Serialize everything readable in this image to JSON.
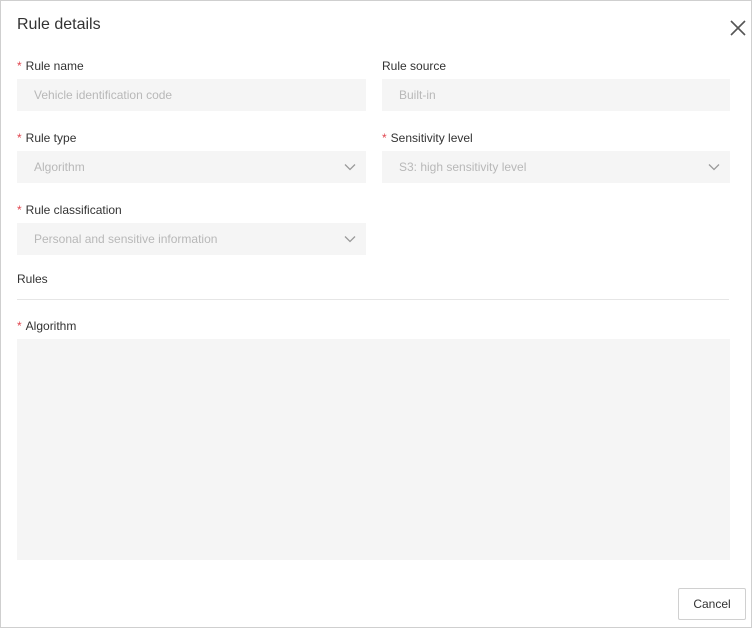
{
  "dialog": {
    "title": "Rule details",
    "close_icon": "close-icon"
  },
  "form": {
    "required_marker": "*",
    "rule_name": {
      "label": "Rule name",
      "required": true,
      "value": "Vehicle identification code"
    },
    "rule_source": {
      "label": "Rule source",
      "required": false,
      "value": "Built-in"
    },
    "rule_type": {
      "label": "Rule type",
      "required": true,
      "value": "Algorithm",
      "icon": "chevron-down-icon"
    },
    "sensitivity_level": {
      "label": "Sensitivity level",
      "required": true,
      "value": "S3: high sensitivity level",
      "icon": "chevron-down-icon"
    },
    "rule_classification": {
      "label": "Rule classification",
      "required": true,
      "value": "Personal and sensitive information",
      "icon": "chevron-down-icon"
    }
  },
  "rules_section": {
    "title": "Rules",
    "algorithm": {
      "label": "Algorithm",
      "required": true,
      "value": ""
    }
  },
  "footer": {
    "cancel_label": "Cancel"
  },
  "colors": {
    "required": "#e0464f",
    "field_bg": "#f5f5f5",
    "disabled_text": "#b8b8b8",
    "text": "#333333"
  }
}
